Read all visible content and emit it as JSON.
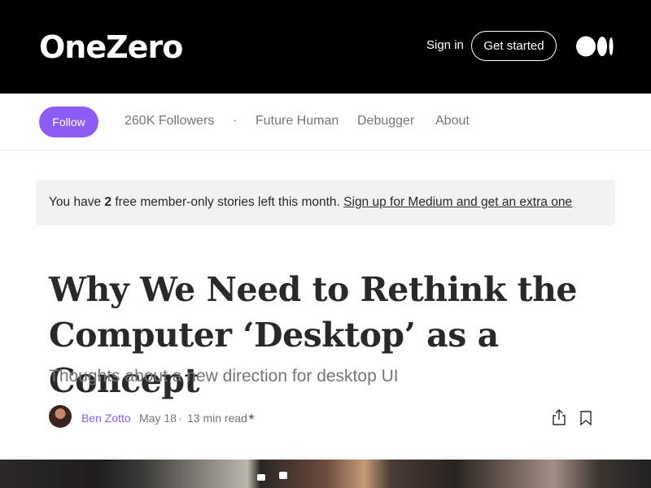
{
  "header": {
    "logo_text": "OneZero",
    "signin_label": "Sign in",
    "getstarted_label": "Get started",
    "medium_icon": "medium-logo-icon"
  },
  "subnav": {
    "follow_label": "Follow",
    "followers": "260K Followers",
    "separator": "·",
    "links": [
      "Future Human",
      "Debugger",
      "About"
    ]
  },
  "banner": {
    "prefix": "You have ",
    "count": "2",
    "suffix": " free member-only stories left this month. ",
    "link": "Sign up for Medium and get an extra one"
  },
  "article": {
    "title_line1": "Why We Need to Rethink the",
    "title_line2": "Computer ‘Desktop’ as a Concept",
    "subtitle": "Thoughts about a new direction for desktop UI",
    "author": "Ben Zotto",
    "date": "May 18",
    "separator": "·",
    "read_time": "13 min read",
    "member_star": "★"
  },
  "colors": {
    "accent": "#8c5cf5",
    "topbar": "#000000",
    "banner_bg": "#f2f2f2"
  }
}
